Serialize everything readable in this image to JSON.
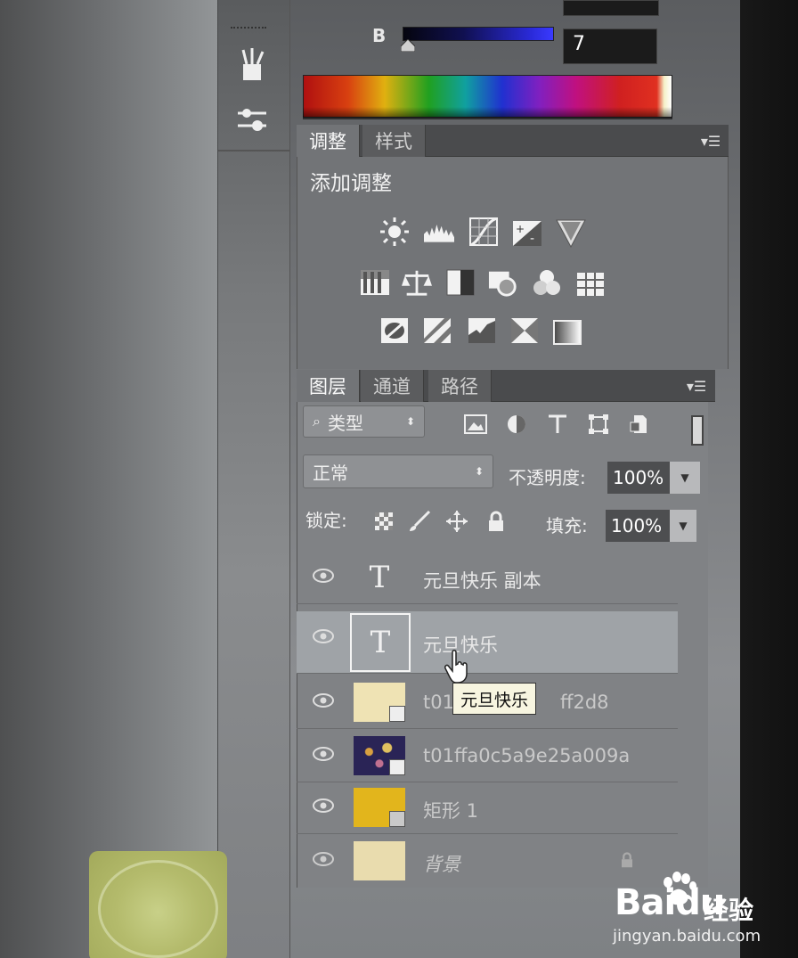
{
  "color_panel": {
    "b_label": "B",
    "b_value": "7",
    "top_value": ""
  },
  "adjustments_panel": {
    "tabs": [
      {
        "label": "调整",
        "active": true
      },
      {
        "label": "样式",
        "active": false
      }
    ],
    "title": "添加调整",
    "icons_row1": [
      "brightness-contrast-icon",
      "levels-icon",
      "curves-icon",
      "exposure-icon",
      "vibrance-icon"
    ],
    "icons_row2": [
      "hue-saturation-icon",
      "color-balance-icon",
      "black-white-icon",
      "photo-filter-icon",
      "channel-mixer-icon",
      "color-lookup-icon"
    ],
    "icons_row3": [
      "invert-icon",
      "posterize-icon",
      "threshold-icon",
      "selective-color-icon",
      "gradient-map-icon"
    ]
  },
  "layers_panel": {
    "tabs": [
      {
        "label": "图层",
        "active": true
      },
      {
        "label": "通道",
        "active": false
      },
      {
        "label": "路径",
        "active": false
      }
    ],
    "filter_kind": "类型",
    "blend_mode": "正常",
    "opacity_label": "不透明度:",
    "opacity_value": "100%",
    "lock_label": "锁定:",
    "fill_label": "填充:",
    "fill_value": "100%",
    "layers": [
      {
        "name": "元旦快乐 副本",
        "type": "text",
        "selected": false
      },
      {
        "name": "元旦快乐",
        "type": "text",
        "selected": true
      },
      {
        "name": "t01",
        "name_tail": "ff2d8",
        "type": "smart-image",
        "selected": false
      },
      {
        "name": "t01ffa0c5a9e25a009a",
        "type": "smart-image",
        "selected": false
      },
      {
        "name": "矩形 1",
        "type": "shape",
        "selected": false
      },
      {
        "name": "背景",
        "type": "background",
        "selected": false
      }
    ],
    "tooltip": "元旦快乐"
  },
  "watermark": {
    "brand_bai": "Bai",
    "brand_du": "du",
    "brand_cn": "经验",
    "url": "jingyan.baidu.com"
  },
  "colors": {
    "panel_bg": "#727477",
    "selected_row": "#9fa3a7",
    "tooltip_bg": "#f7f5e0"
  }
}
